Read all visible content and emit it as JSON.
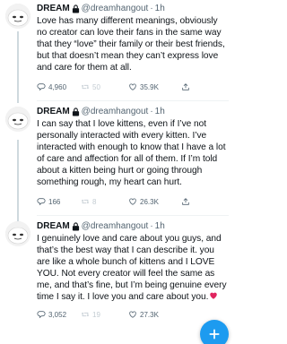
{
  "tweets": [
    {
      "name": "DREAM",
      "handle": "@dreamhangout",
      "dot": "·",
      "time": "1h",
      "text": "Love has many different meanings, obviously no creator can love their fans in the same way that they “love” their family or their best friends, but that doesn’t mean they can’t express love and care for them at all.",
      "replies": "4,960",
      "retweets": "50",
      "likes": "35.9K"
    },
    {
      "name": "DREAM",
      "handle": "@dreamhangout",
      "dot": "·",
      "time": "1h",
      "text": "I can say that I love kittens, even if I’ve not personally interacted with every kitten. I’ve interacted with enough to know that I have a lot of care and affection for all of them. If I’m told about a kitten being hurt or going through something rough, my heart can hurt.",
      "replies": "166",
      "retweets": "8",
      "likes": "26.3K"
    },
    {
      "name": "DREAM",
      "handle": "@dreamhangout",
      "dot": "·",
      "time": "1h",
      "text": "I genuinely love and care about you guys, and that’s the best way that I can describe it. you are like a whole bunch of kittens and I LOVE YOU. Not every creator will feel the same as me, and that’s fine, but I’m being genuine every time I say it. I love you and care about you.",
      "replies": "3,052",
      "retweets": "19",
      "likes": "27.3K"
    }
  ],
  "icons": {
    "lock": "lock-icon",
    "reply": "reply-icon",
    "retweet": "retweet-icon",
    "like": "heart-outline-icon",
    "share": "share-icon",
    "emoji": "red-heart-emoji",
    "compose": "compose-plus-icon"
  },
  "colors": {
    "accent": "#1d9bf0",
    "muted": "#536471",
    "heart_emoji": "#e0245e"
  }
}
